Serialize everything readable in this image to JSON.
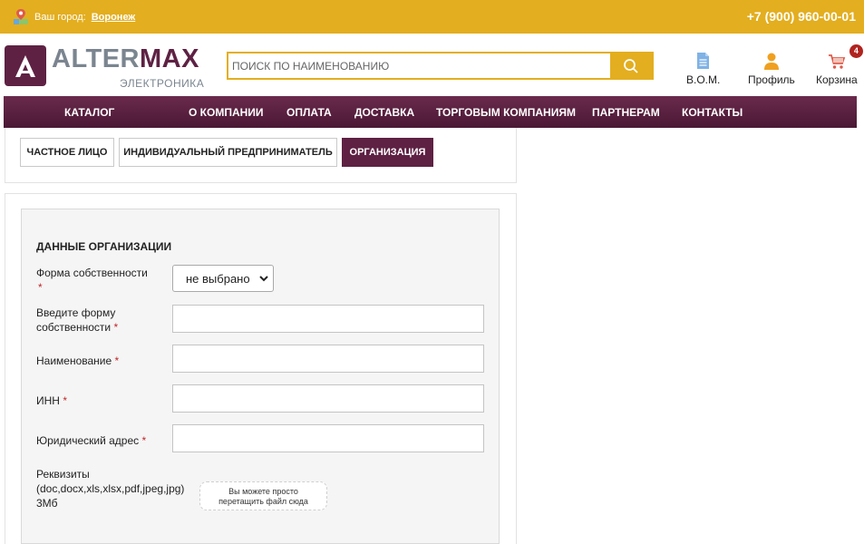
{
  "topbar": {
    "city_label": "Ваш город:",
    "city_name": "Воронеж",
    "phone": "+7 (900) 960-00-01"
  },
  "brand": {
    "part1": "ALTER",
    "part2": "MAX",
    "subtitle": "ЭЛЕКТРОНИКА"
  },
  "search": {
    "placeholder": "ПОИСК ПО НАИМЕНОВАНИЮ"
  },
  "header_icons": {
    "bom_label": "B.O.M.",
    "profile_label": "Профиль",
    "cart_label": "Корзина",
    "cart_count": "4"
  },
  "nav": [
    {
      "label": "КАТАЛОГ"
    },
    {
      "label": "О КОМПАНИИ"
    },
    {
      "label": "ОПЛАТА"
    },
    {
      "label": "ДОСТАВКА"
    },
    {
      "label": "ТОРГОВЫМ КОМПАНИЯМ"
    },
    {
      "label": "ПАРТНЕРАМ"
    },
    {
      "label": "КОНТАКТЫ"
    }
  ],
  "tabs": [
    {
      "label": "ЧАСТНОЕ ЛИЦО"
    },
    {
      "label": "ИНДИВИДУАЛЬНЫЙ ПРЕДПРИНИМАТЕЛЬ"
    },
    {
      "label": "ОРГАНИЗАЦИЯ"
    }
  ],
  "active_tab": "ОРГАНИЗАЦИЯ",
  "form": {
    "title": "ДАННЫЕ ОРГАНИЗАЦИИ",
    "required_mark": "*",
    "ownership_label": "Форма собственности",
    "ownership_value": "не выбрано",
    "enter_ownership_line1": "Введите форму",
    "enter_ownership_line2": "собственности",
    "name_label": "Наименование",
    "inn_label": "ИНН",
    "address_label": "Юридический адрес",
    "files_line1": "Реквизиты",
    "files_line2": "(doc,docx,xls,xlsx,pdf,jpeg,jpg)",
    "files_line3": "3Мб",
    "drop_line1": "Вы можете просто",
    "drop_line2": "перетащить файл сюда"
  },
  "colors": {
    "accent_yellow": "#e3ae1f",
    "brand_purple": "#5e2143",
    "brand_gray": "#7b8590",
    "required_red": "#c0282a",
    "badge_red": "#b0231f",
    "profile_orange": "#f0a020",
    "bom_blue": "#7fb2e5"
  }
}
